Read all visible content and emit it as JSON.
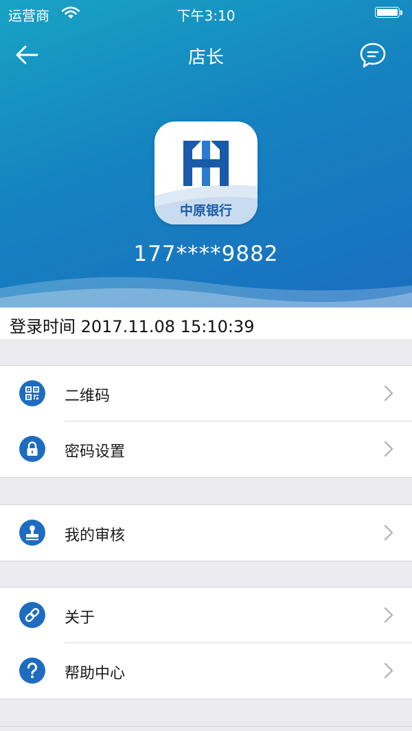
{
  "status_bar": {
    "carrier": "运营商",
    "time": "下午3:10"
  },
  "nav": {
    "title": "店长"
  },
  "profile": {
    "logo_text": "中原银行",
    "phone": "177****9882",
    "login_time": "登录时间 2017.11.08 15:10:39"
  },
  "menu": {
    "qrcode": {
      "label": "二维码",
      "icon": "qr-code-icon"
    },
    "password": {
      "label": "密码设置",
      "icon": "lock-icon"
    },
    "review": {
      "label": "我的审核",
      "icon": "stamp-icon"
    },
    "about": {
      "label": "关于",
      "icon": "link-icon"
    },
    "help": {
      "label": "帮助中心",
      "icon": "question-icon"
    }
  },
  "colors": {
    "header_gradient_start": "#18a3c4",
    "header_gradient_end": "#1a6ec0",
    "icon_blue": "#1e6cbf",
    "page_background": "#ececf0"
  }
}
